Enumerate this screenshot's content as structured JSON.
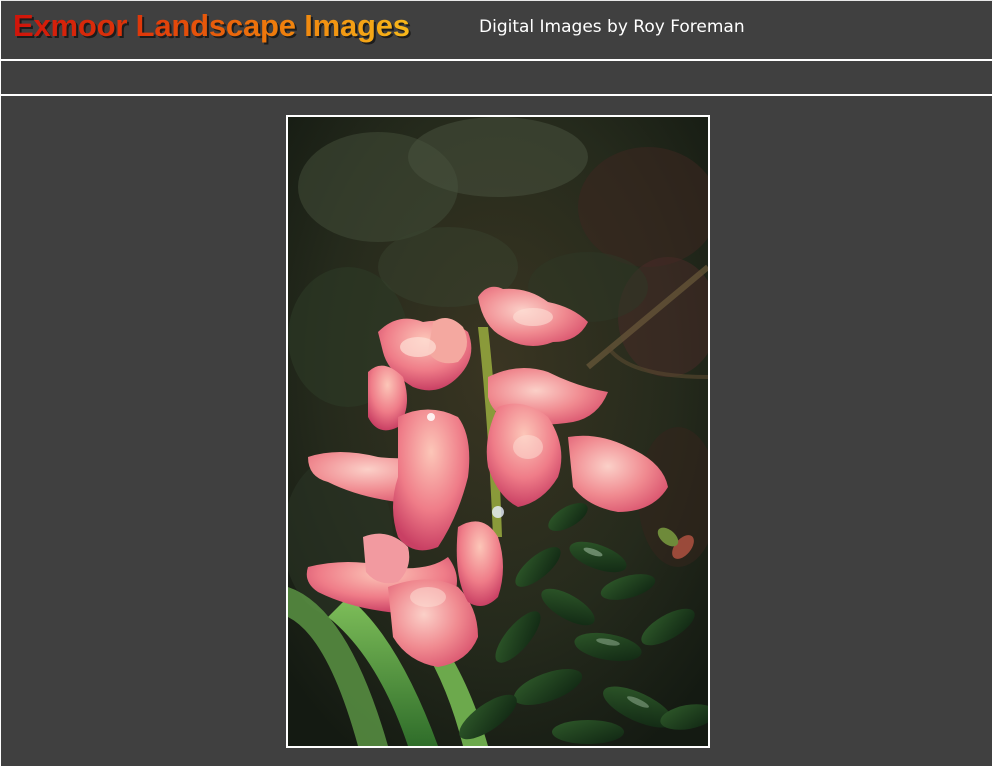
{
  "header": {
    "title": "Exmoor Landscape Images",
    "subtitle": "Digital Images by Roy Foreman"
  },
  "colors": {
    "background": "#404040",
    "divider": "#ffffff",
    "title_gradient_start": "#d0140a",
    "title_gradient_end": "#f7b81a",
    "subtitle_text": "#ffffff"
  },
  "photo": {
    "subject": "pink hyacinth flowers with rain drops and dark green leaves"
  }
}
